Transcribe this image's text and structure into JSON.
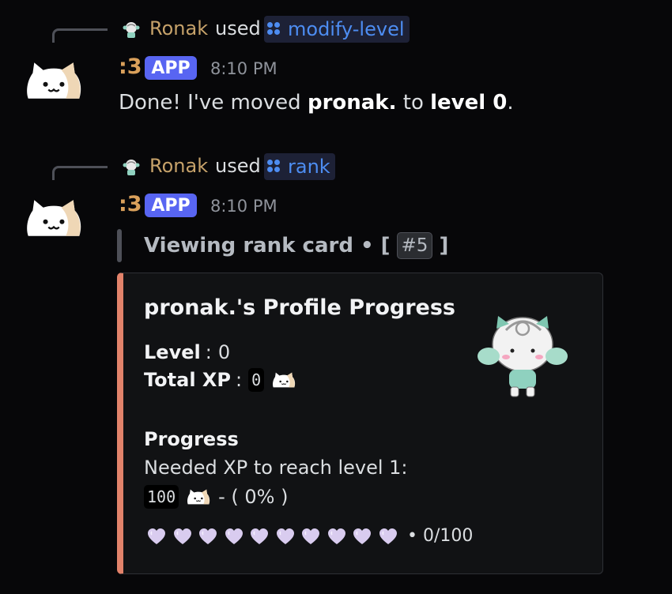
{
  "messages": [
    {
      "reply": {
        "user": "Ronak",
        "verb": "used",
        "command": "modify-level"
      },
      "author": ":3",
      "badge": "APP",
      "time": "8:10 PM",
      "content": {
        "pre": "Done! I've moved ",
        "name": "pronak.",
        "mid": " to ",
        "level": "level 0",
        "post": "."
      }
    },
    {
      "reply": {
        "user": "Ronak",
        "verb": "used",
        "command": "rank"
      },
      "author": ":3",
      "badge": "APP",
      "time": "8:10 PM",
      "quote": {
        "pre": "Viewing rank card • [",
        "number": "#5",
        "post": "]"
      },
      "embed": {
        "accent_color": "#e2826a",
        "title": "pronak.'s Profile Progress",
        "level_label": "Level",
        "level_value": "0",
        "xp_label": "Total XP",
        "xp_value": "0",
        "progress_label": "Progress",
        "needed_text": "Needed XP to reach level 1:",
        "needed_value": "100",
        "percent_text": "- ( 0% )",
        "hearts_filled": 0,
        "hearts_total": 10,
        "progress_count": "• 0/100"
      }
    }
  ],
  "icons": {
    "command": "slash-command-icon",
    "heart": "heart-icon",
    "cat": "cat-icon"
  },
  "colors": {
    "background": "#070709",
    "app_badge": "#5865f2",
    "link": "#4d8df2",
    "heart": "#d9ccef"
  }
}
